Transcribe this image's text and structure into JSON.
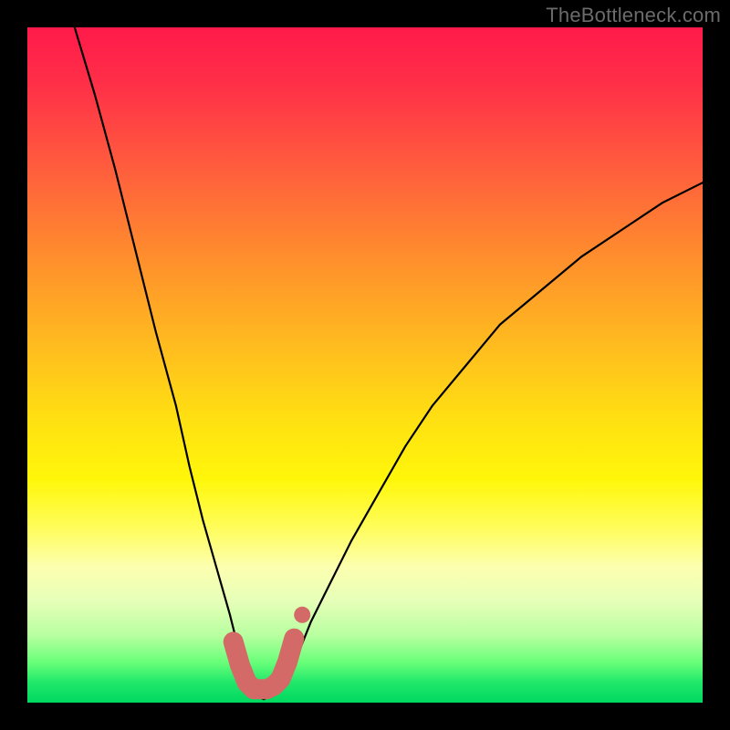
{
  "watermark": "TheBottleneck.com",
  "chart_data": {
    "type": "line",
    "title": "",
    "xlabel": "",
    "ylabel": "",
    "xlim": [
      0,
      100
    ],
    "ylim": [
      0,
      100
    ],
    "grid": false,
    "legend": false,
    "series": [
      {
        "name": "bottleneck-curve",
        "color": "#000000",
        "x": [
          7,
          10,
          13,
          16,
          19,
          22,
          24,
          26,
          28,
          30,
          31,
          32,
          33,
          34,
          35,
          36,
          38,
          40,
          42,
          45,
          48,
          52,
          56,
          60,
          65,
          70,
          76,
          82,
          88,
          94,
          100
        ],
        "y": [
          100,
          90,
          79,
          67,
          55,
          44,
          35,
          27,
          20,
          13,
          9,
          6,
          3,
          1,
          0.5,
          1,
          3,
          7,
          12,
          18,
          24,
          31,
          38,
          44,
          50,
          56,
          61,
          66,
          70,
          74,
          77
        ]
      },
      {
        "name": "highlight-band",
        "color": "#d36a68",
        "x": [
          30.5,
          31.5,
          32.5,
          33.5,
          34.5,
          35.5,
          36.5,
          37.5,
          38.5,
          39.5
        ],
        "y": [
          9,
          5.5,
          3,
          2,
          2,
          2,
          2.5,
          3.5,
          6,
          9.5
        ]
      }
    ],
    "background_gradient": {
      "orientation": "vertical",
      "stops": [
        {
          "pos": 0.0,
          "color": "#ff1a4a"
        },
        {
          "pos": 0.2,
          "color": "#ff5a3e"
        },
        {
          "pos": 0.46,
          "color": "#ffb820"
        },
        {
          "pos": 0.67,
          "color": "#fff70a"
        },
        {
          "pos": 0.85,
          "color": "#e6ffb8"
        },
        {
          "pos": 1.0,
          "color": "#00d860"
        }
      ]
    }
  }
}
